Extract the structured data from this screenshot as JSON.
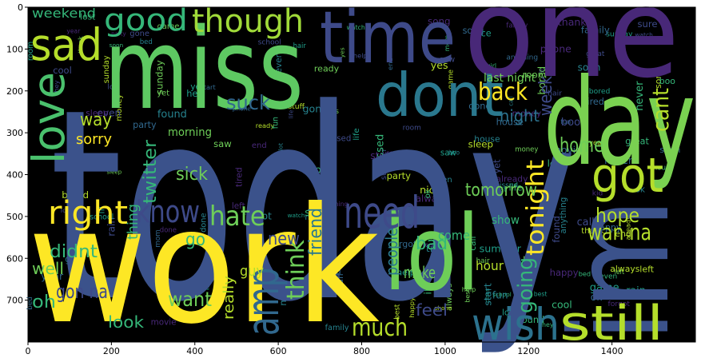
{
  "chart_data": {
    "type": "wordcloud",
    "title": "",
    "xlabel": "",
    "ylabel": "",
    "xlim": [
      0,
      1600
    ],
    "ylim": [
      800,
      0
    ],
    "x_ticks": [
      "0",
      "200",
      "400",
      "600",
      "800",
      "1000",
      "1200",
      "1400"
    ],
    "y_ticks": [
      "0",
      "100",
      "200",
      "300",
      "400",
      "500",
      "600",
      "700"
    ],
    "background": "#000000",
    "words": [
      {
        "text": "today",
        "color": "#3b528b"
      },
      {
        "text": "work",
        "color": "#fde725"
      },
      {
        "text": "im",
        "color": "#3b528b"
      },
      {
        "text": "one",
        "color": "#482878"
      },
      {
        "text": "day",
        "color": "#7ad151"
      },
      {
        "text": "miss",
        "color": "#5ec962"
      },
      {
        "text": "time",
        "color": "#3e4a89"
      },
      {
        "text": "dont",
        "color": "#2a788e"
      },
      {
        "text": "lol",
        "color": "#6ece58"
      },
      {
        "text": "got",
        "color": "#b5de2b"
      },
      {
        "text": "need",
        "color": "#3e4a89"
      },
      {
        "text": "wish",
        "color": "#2c728e"
      },
      {
        "text": "still",
        "color": "#b5de2b"
      },
      {
        "text": "sad",
        "color": "#b5de2b"
      },
      {
        "text": "good",
        "color": "#35b779"
      },
      {
        "text": "though",
        "color": "#a0da39"
      },
      {
        "text": "love",
        "color": "#4ac16d"
      },
      {
        "text": "know",
        "color": "#3e4a89"
      },
      {
        "text": "hate",
        "color": "#6ece58"
      },
      {
        "text": "right",
        "color": "#fde725"
      },
      {
        "text": "amp",
        "color": "#31688e"
      },
      {
        "text": "much",
        "color": "#b5de2b"
      },
      {
        "text": "back",
        "color": "#fde725"
      },
      {
        "text": "tonight",
        "color": "#fde725"
      },
      {
        "text": "going",
        "color": "#35b779"
      },
      {
        "text": "home",
        "color": "#6ece58"
      },
      {
        "text": "week",
        "color": "#3e4a89"
      },
      {
        "text": "cant",
        "color": "#b5de2b"
      },
      {
        "text": "hope",
        "color": "#b5de2b"
      },
      {
        "text": "suck",
        "color": "#31688e"
      },
      {
        "text": "twitter",
        "color": "#35b779"
      },
      {
        "text": "tomorrow",
        "color": "#6ece58"
      },
      {
        "text": "want",
        "color": "#6ece58"
      },
      {
        "text": "gon na",
        "color": "#3e4a89"
      },
      {
        "text": "oh",
        "color": "#35b779"
      },
      {
        "text": "make",
        "color": "#6ece58"
      },
      {
        "text": "bad",
        "color": "#35b779"
      },
      {
        "text": "wan na",
        "color": "#b5de2b"
      },
      {
        "text": "think",
        "color": "#6ece58"
      },
      {
        "text": "friend",
        "color": "#2a788e"
      },
      {
        "text": "sorry",
        "color": "#fde725"
      },
      {
        "text": "way",
        "color": "#b5de2b"
      },
      {
        "text": "sick",
        "color": "#6ece58"
      },
      {
        "text": "didnt",
        "color": "#35b779"
      },
      {
        "text": "well",
        "color": "#6ece58"
      },
      {
        "text": "new",
        "color": "#3e4a89"
      },
      {
        "text": "people",
        "color": "#2a788e"
      },
      {
        "text": "night",
        "color": "#2c728e"
      },
      {
        "text": "look",
        "color": "#35b779"
      },
      {
        "text": "feel",
        "color": "#3e4a89"
      },
      {
        "text": "weekend",
        "color": "#35b779"
      },
      {
        "text": "last night",
        "color": "#6ece58"
      },
      {
        "text": "come",
        "color": "#35b779"
      },
      {
        "text": "really",
        "color": "#b5de2b"
      },
      {
        "text": "hour",
        "color": "#b5de2b"
      },
      {
        "text": "guy",
        "color": "#b5de2b"
      },
      {
        "text": "thing",
        "color": "#35b779"
      },
      {
        "text": "go",
        "color": "#35b779"
      },
      {
        "text": "show",
        "color": "#35b779"
      },
      {
        "text": "morning",
        "color": "#6ece58"
      }
    ],
    "small_words": [
      "bed",
      "missed",
      "life",
      "hair",
      "nice",
      "left",
      "end",
      "forgot",
      "fun",
      "gone",
      "school",
      "summer",
      "sunday",
      "always",
      "stuff",
      "tired",
      "never",
      "even",
      "great",
      "room",
      "best",
      "already",
      "song",
      "anything",
      "ok",
      "call",
      "lost",
      "yet",
      "bored",
      "sleep",
      "phone",
      "movie",
      "start",
      "girl",
      "watch",
      "rain",
      "game",
      "money",
      "year",
      "kid",
      "house",
      "found",
      "ill",
      "saw",
      "yes",
      "ready",
      "party",
      "family",
      "mom",
      "boo",
      "cool",
      "sure",
      "class",
      "thank",
      "happy",
      "done",
      "soon",
      "lot",
      "hey",
      "help"
    ]
  }
}
